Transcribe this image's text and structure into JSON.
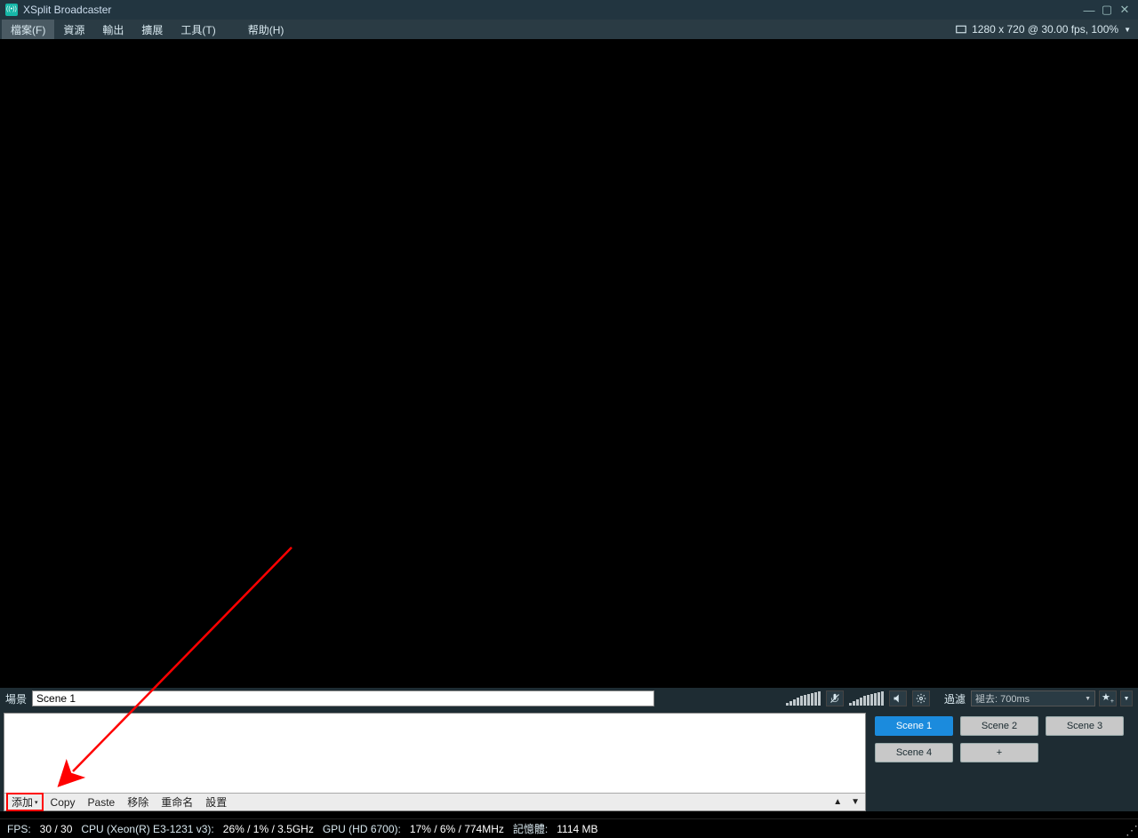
{
  "titlebar": {
    "title": "XSplit Broadcaster"
  },
  "menubar": {
    "items": [
      {
        "label": "檔案(F)",
        "hl": true
      },
      {
        "label": "資源"
      },
      {
        "label": "輸出"
      },
      {
        "label": "擴展"
      },
      {
        "label": "工具(T)"
      },
      {
        "label": "帮助(H)"
      }
    ],
    "resolution": "1280 x 720 @ 30.00 fps, 100%"
  },
  "sceneBar": {
    "label": "場景",
    "currentScene": "Scene 1",
    "transitionLabel": "過濾",
    "transitionValue": "褪去: 700ms"
  },
  "sourcesToolbar": {
    "add": "添加",
    "copy": "Copy",
    "paste": "Paste",
    "remove": "移除",
    "rename": "重命名",
    "settings": "設置"
  },
  "scenes": {
    "items": [
      {
        "label": "Scene 1",
        "active": true
      },
      {
        "label": "Scene 2"
      },
      {
        "label": "Scene 3"
      },
      {
        "label": "Scene 4"
      },
      {
        "label": "+"
      }
    ]
  },
  "statusbar": {
    "fpsLabel": "FPS:",
    "fps": "30 / 30",
    "cpuLabel": "CPU (Xeon(R) E3-1231 v3):",
    "cpu": "26% / 1% / 3.5GHz",
    "gpuLabel": "GPU (HD 6700):",
    "gpu": "17% / 6% / 774MHz",
    "memLabel": "記憶體:",
    "mem": "1114 MB"
  }
}
